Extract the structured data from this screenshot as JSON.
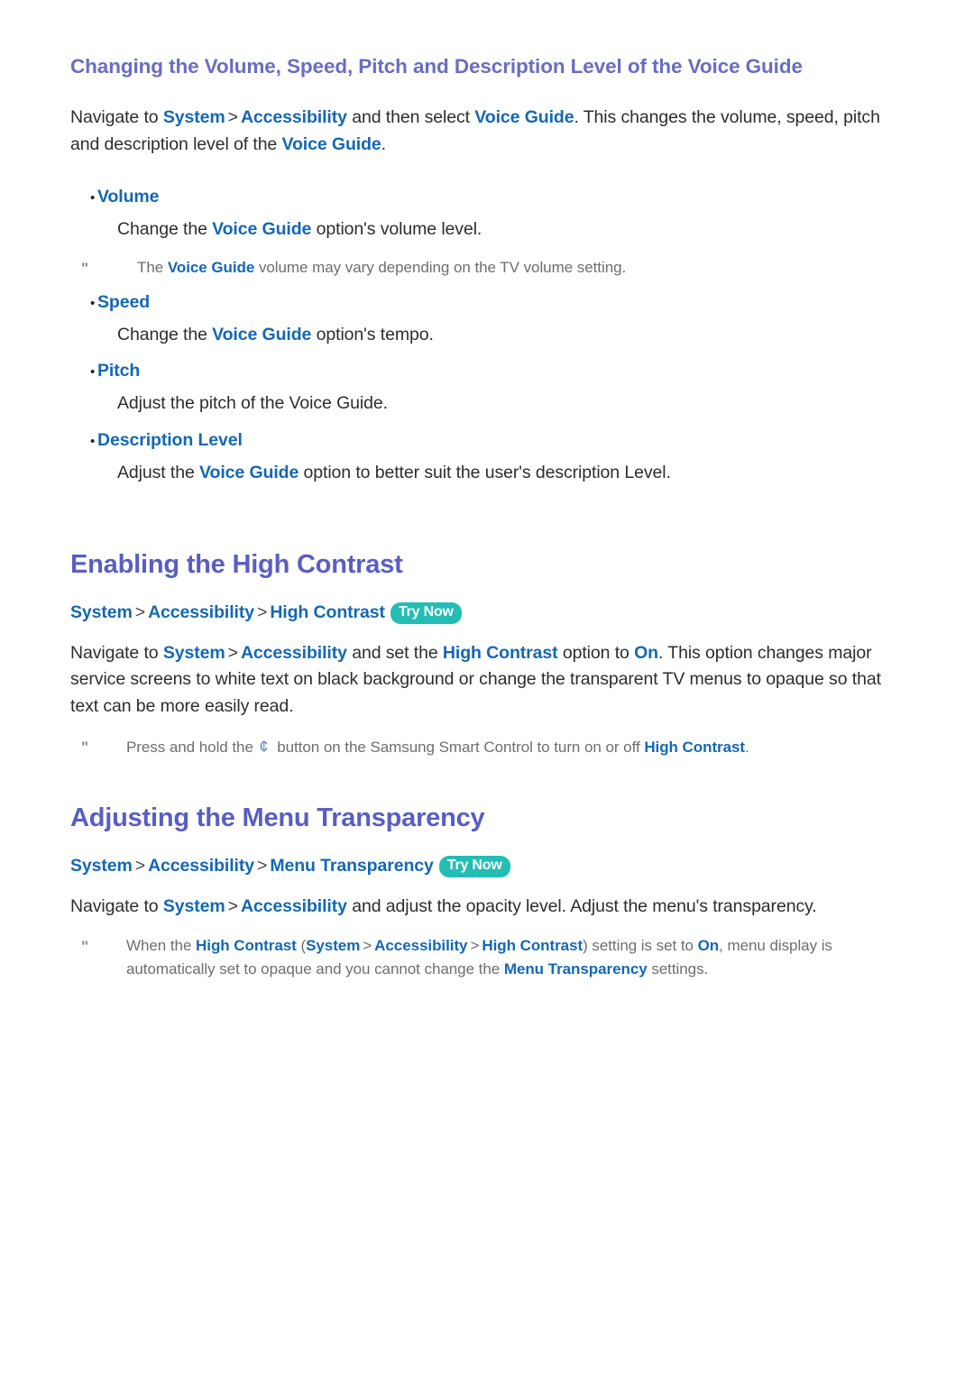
{
  "page": {
    "colors": {
      "section_heading": "#6a6dc0",
      "chapter_heading": "#5a5ec2",
      "link": "#1468b3",
      "body_text": "#2d2d2d",
      "note_text": "#6e6e6e",
      "try_now_badge_bg": "#23bdb3",
      "try_now_badge_text": "#ffffff",
      "background": "#ffffff"
    },
    "separator": ">",
    "note_marker": "\"",
    "bullet_glyph": "•"
  },
  "section1": {
    "heading": "Changing the Volume, Speed, Pitch and Description Level of the Voice Guide",
    "intro": {
      "t1": "Navigate to ",
      "l1": "System",
      "l2": "Accessibility",
      "t2": " and then select ",
      "l3": "Voice Guide",
      "t3": ". This changes the volume, speed, pitch and description level of the ",
      "l4": "Voice Guide",
      "t4": "."
    },
    "items": [
      {
        "label": "Volume",
        "desc_t1": "Change the ",
        "desc_l1": "Voice Guide",
        "desc_t2": " option's volume level.",
        "note": {
          "t1": "The ",
          "l1": "Voice Guide",
          "t2": " volume may vary depending on the TV volume setting."
        }
      },
      {
        "label": "Speed",
        "desc_t1": "Change the ",
        "desc_l1": "Voice Guide",
        "desc_t2": " option's tempo."
      },
      {
        "label": "Pitch",
        "desc_t1": "Adjust the pitch of the Voice Guide.",
        "desc_l1": "",
        "desc_t2": ""
      },
      {
        "label": "Description Level",
        "desc_t1": "Adjust the ",
        "desc_l1": "Voice Guide",
        "desc_t2": " option to better suit the user's description Level."
      }
    ]
  },
  "section2": {
    "heading": "Enabling the High Contrast",
    "path": {
      "p1": "System",
      "p2": "Accessibility",
      "p3": "High Contrast",
      "badge": "Try Now"
    },
    "body": {
      "t1": "Navigate to ",
      "l1": "System",
      "l2": "Accessibility",
      "t2": " and set the ",
      "l3": "High Contrast",
      "t3": " option to ",
      "l4": "On",
      "t4": ". This option changes major service screens to white text on black background or change the transparent TV menus to opaque so that text can be more easily read."
    },
    "note": {
      "t1": "Press and hold the ",
      "glyph": "¢",
      "t2": " button on the Samsung Smart Control to turn on or off ",
      "l1": "High Contrast",
      "t3": "."
    }
  },
  "section3": {
    "heading": "Adjusting the Menu Transparency",
    "path": {
      "p1": "System",
      "p2": "Accessibility",
      "p3": "Menu Transparency",
      "badge": "Try Now"
    },
    "body": {
      "t1": "Navigate to ",
      "l1": "System",
      "l2": "Accessibility",
      "t2": " and adjust the opacity level. Adjust the menu's transparency."
    },
    "note": {
      "t1": "When the ",
      "l1": "High Contrast",
      "t2": " (",
      "l2": "System",
      "l3": "Accessibility",
      "l4": "High Contrast",
      "t3": ") setting is set to ",
      "l5": "On",
      "t4": ", menu display is automatically set to opaque and you cannot change the ",
      "l6": "Menu Transparency",
      "t5": " settings."
    }
  }
}
